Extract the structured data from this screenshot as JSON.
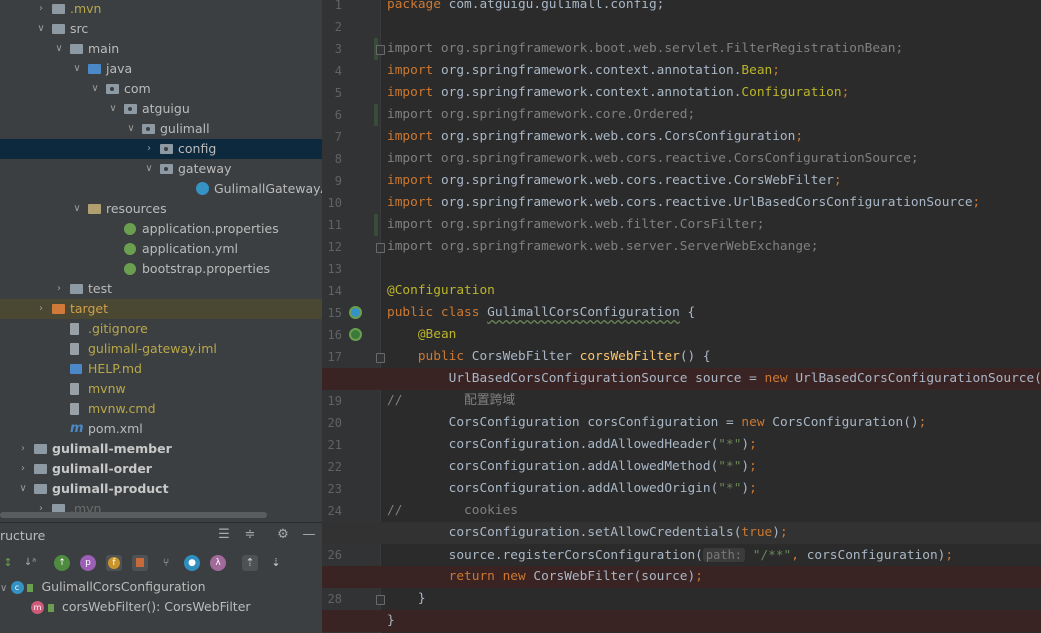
{
  "project_tree": [
    {
      "depth": 2,
      "chev": "right",
      "icon": "folder",
      "label": ".mvn",
      "style": "yellow"
    },
    {
      "depth": 2,
      "chev": "down",
      "icon": "folder",
      "label": "src"
    },
    {
      "depth": 3,
      "chev": "down",
      "icon": "folder",
      "label": "main"
    },
    {
      "depth": 4,
      "chev": "down",
      "icon": "src",
      "label": "java"
    },
    {
      "depth": 5,
      "chev": "down",
      "icon": "pkg",
      "label": "com"
    },
    {
      "depth": 6,
      "chev": "down",
      "icon": "pkg",
      "label": "atguigu"
    },
    {
      "depth": 7,
      "chev": "down",
      "icon": "pkg",
      "label": "gulimall"
    },
    {
      "depth": 8,
      "chev": "right",
      "icon": "pkg",
      "label": "config",
      "selected": true
    },
    {
      "depth": 8,
      "chev": "down",
      "icon": "pkg",
      "label": "gateway"
    },
    {
      "depth": 10,
      "chev": "",
      "icon": "classc",
      "label": "GulimallGatewayApplic"
    },
    {
      "depth": 4,
      "chev": "down",
      "icon": "res",
      "label": "resources"
    },
    {
      "depth": 6,
      "chev": "",
      "icon": "spring",
      "label": "application.properties"
    },
    {
      "depth": 6,
      "chev": "",
      "icon": "spring",
      "label": "application.yml"
    },
    {
      "depth": 6,
      "chev": "",
      "icon": "spring",
      "label": "bootstrap.properties"
    },
    {
      "depth": 3,
      "chev": "right",
      "icon": "folder",
      "label": "test"
    },
    {
      "depth": 2,
      "chev": "right",
      "icon": "excl",
      "label": "target",
      "style": "orange",
      "highlight": true
    },
    {
      "depth": 3,
      "chev": "",
      "icon": "file",
      "label": ".gitignore",
      "style": "yellow"
    },
    {
      "depth": 3,
      "chev": "",
      "icon": "file",
      "label": "gulimall-gateway.iml",
      "style": "yellow"
    },
    {
      "depth": 3,
      "chev": "",
      "icon": "mdfile",
      "label": "HELP.md",
      "style": "yellow"
    },
    {
      "depth": 3,
      "chev": "",
      "icon": "file",
      "label": "mvnw",
      "style": "yellow"
    },
    {
      "depth": 3,
      "chev": "",
      "icon": "file",
      "label": "mvnw.cmd",
      "style": "yellow"
    },
    {
      "depth": 3,
      "chev": "",
      "icon": "maven",
      "label": "pom.xml"
    },
    {
      "depth": 1,
      "chev": "right",
      "icon": "folder",
      "label": "gulimall-member",
      "style": "bold"
    },
    {
      "depth": 1,
      "chev": "right",
      "icon": "folder",
      "label": "gulimall-order",
      "style": "bold"
    },
    {
      "depth": 1,
      "chev": "down",
      "icon": "folder",
      "label": "gulimall-product",
      "style": "bold"
    },
    {
      "depth": 2,
      "chev": "right",
      "icon": "folder",
      "label": ".mvn",
      "style": "dim"
    }
  ],
  "structure": {
    "title": "ructure",
    "class_name": "GulimallCorsConfiguration",
    "method_name": "corsWebFilter(): CorsWebFilter"
  },
  "editor": {
    "current_line": 25,
    "lines": [
      {
        "n": 1,
        "segs": [
          [
            "kw",
            "package "
          ],
          [
            "",
            "com.atguigu.gulimall.config;"
          ]
        ]
      },
      {
        "n": 2,
        "segs": []
      },
      {
        "n": 3,
        "fold": true,
        "vcs": true,
        "segs": [
          [
            "unused",
            "import org.springframework.boot.web.servlet.FilterRegistrationBean;"
          ]
        ]
      },
      {
        "n": 4,
        "segs": [
          [
            "kw",
            "import "
          ],
          [
            "",
            "org.springframework.context.annotation."
          ],
          [
            "ann",
            "Bean"
          ],
          [
            "kw",
            ";"
          ]
        ]
      },
      {
        "n": 5,
        "segs": [
          [
            "kw",
            "import "
          ],
          [
            "",
            "org.springframework.context.annotation."
          ],
          [
            "ann",
            "Configuration"
          ],
          [
            "kw",
            ";"
          ]
        ]
      },
      {
        "n": 6,
        "vcs": true,
        "segs": [
          [
            "unused",
            "import org.springframework.core.Ordered;"
          ]
        ]
      },
      {
        "n": 7,
        "segs": [
          [
            "kw",
            "import "
          ],
          [
            "",
            "org.springframework.web.cors.CorsConfiguration"
          ],
          [
            "kw",
            ";"
          ]
        ]
      },
      {
        "n": 8,
        "segs": [
          [
            "unused",
            "import org.springframework.web.cors.reactive.CorsConfigurationSource;"
          ]
        ]
      },
      {
        "n": 9,
        "segs": [
          [
            "kw",
            "import "
          ],
          [
            "",
            "org.springframework.web.cors.reactive.CorsWebFilter"
          ],
          [
            "kw",
            ";"
          ]
        ]
      },
      {
        "n": 10,
        "segs": [
          [
            "kw",
            "import "
          ],
          [
            "",
            "org.springframework.web.cors.reactive.UrlBasedCorsConfigurationSource"
          ],
          [
            "kw",
            ";"
          ]
        ]
      },
      {
        "n": 11,
        "vcs": true,
        "segs": [
          [
            "unused",
            "import org.springframework.web.filter.CorsFilter;"
          ]
        ]
      },
      {
        "n": 12,
        "fold": true,
        "segs": [
          [
            "unused",
            "import org.springframework.web.server.ServerWebExchange;"
          ]
        ]
      },
      {
        "n": 13,
        "segs": []
      },
      {
        "n": 14,
        "segs": [
          [
            "ann",
            "@Configuration"
          ]
        ]
      },
      {
        "n": 15,
        "gicon": "bean-class",
        "segs": [
          [
            "kw",
            "public class "
          ],
          [
            "typo",
            "GulimallCorsConfiguration"
          ],
          [
            "",
            " {"
          ]
        ]
      },
      {
        "n": 16,
        "gicon": "bean-method",
        "segs": [
          [
            "",
            "    "
          ],
          [
            "ann",
            "@Bean"
          ]
        ]
      },
      {
        "n": 17,
        "fold": true,
        "segs": [
          [
            "",
            "    "
          ],
          [
            "kw",
            "public "
          ],
          [
            "",
            "CorsWebFilter "
          ],
          [
            "fn",
            "corsWebFilter"
          ],
          [
            "",
            "() {"
          ]
        ]
      },
      {
        "n": 18,
        "bp": true,
        "segs": [
          [
            "",
            "        UrlBasedCorsConfigurationSource source = "
          ],
          [
            "kw",
            "new "
          ],
          [
            "",
            "UrlBasedCorsConfigurationSource(new"
          ]
        ]
      },
      {
        "n": 19,
        "segs": [
          [
            "cmt",
            "//        配置跨域"
          ]
        ]
      },
      {
        "n": 20,
        "segs": [
          [
            "",
            "        CorsConfiguration corsConfiguration = "
          ],
          [
            "kw",
            "new "
          ],
          [
            "",
            "CorsConfiguration()"
          ],
          [
            "kw",
            ";"
          ]
        ]
      },
      {
        "n": 21,
        "segs": [
          [
            "",
            "        corsConfiguration.addAllowedHeader("
          ],
          [
            "str",
            "\"*\""
          ],
          [
            "",
            ")"
          ],
          [
            "kw",
            ";"
          ]
        ]
      },
      {
        "n": 22,
        "segs": [
          [
            "",
            "        corsConfiguration.addAllowedMethod("
          ],
          [
            "str",
            "\"*\""
          ],
          [
            "",
            ")"
          ],
          [
            "kw",
            ";"
          ]
        ]
      },
      {
        "n": 23,
        "segs": [
          [
            "",
            "        corsConfiguration.addAllowedOrigin("
          ],
          [
            "str",
            "\"*\""
          ],
          [
            "",
            ")"
          ],
          [
            "kw",
            ";"
          ]
        ]
      },
      {
        "n": 24,
        "segs": [
          [
            "cmt",
            "//        cookies"
          ]
        ]
      },
      {
        "n": 25,
        "segs": [
          [
            "",
            "        corsConfiguration.setAllowCredentials("
          ],
          [
            "kw",
            "true"
          ],
          [
            "",
            ")"
          ],
          [
            "kw",
            ";"
          ]
        ]
      },
      {
        "n": 26,
        "segs": [
          [
            "",
            "        source.registerCorsConfiguration("
          ],
          [
            "hint",
            "path:"
          ],
          [
            "",
            " "
          ],
          [
            "str",
            "\"/**\""
          ],
          [
            "kw",
            ", "
          ],
          [
            "",
            "corsConfiguration)"
          ],
          [
            "kw",
            ";"
          ]
        ]
      },
      {
        "n": 27,
        "bp": true,
        "segs": [
          [
            "",
            "        "
          ],
          [
            "kw",
            "return new "
          ],
          [
            "",
            "CorsWebFilter(source)"
          ],
          [
            "kw",
            ";"
          ]
        ]
      },
      {
        "n": 28,
        "fold": true,
        "segs": [
          [
            "",
            "    }"
          ]
        ]
      },
      {
        "n": 29,
        "bp": true,
        "segs": [
          [
            "",
            "}"
          ]
        ]
      }
    ]
  }
}
